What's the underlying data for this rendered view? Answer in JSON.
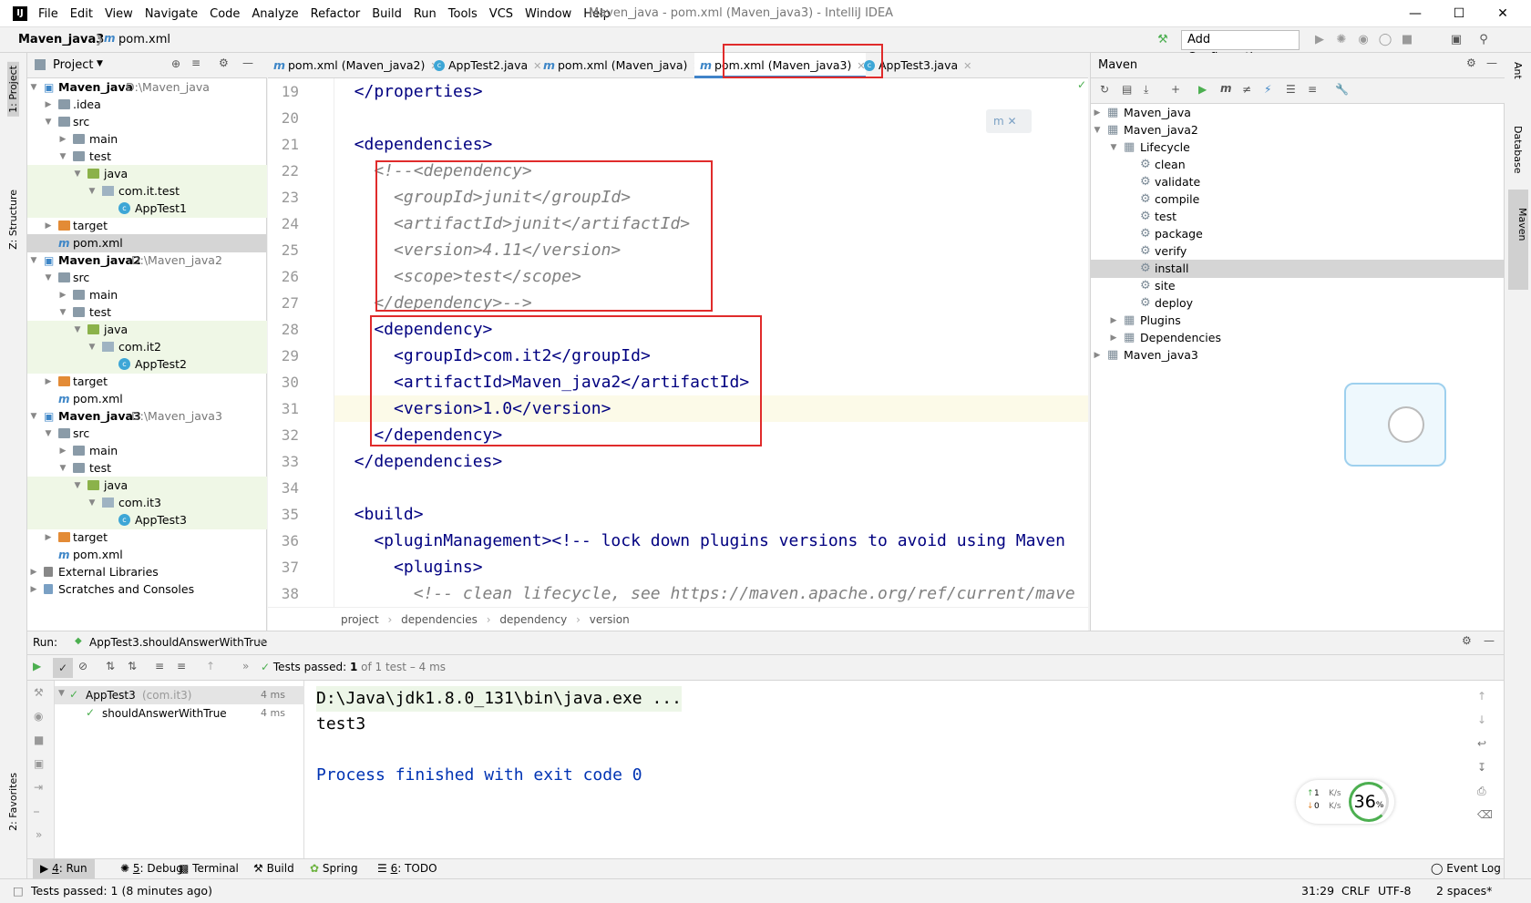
{
  "window": {
    "title": "Maven_java - pom.xml (Maven_java3) - IntelliJ IDEA",
    "logo": "IJ"
  },
  "menu": [
    "File",
    "Edit",
    "View",
    "Navigate",
    "Code",
    "Analyze",
    "Refactor",
    "Build",
    "Run",
    "Tools",
    "VCS",
    "Window",
    "Help"
  ],
  "navbar": {
    "project": "Maven_java3",
    "file": "pom.xml",
    "add_config": "Add Configuration..."
  },
  "left_strip": {
    "project": "1: Project",
    "structure": "Z: Structure",
    "favorites": "2: Favorites"
  },
  "right_strip": {
    "ant": "Ant",
    "database": "Database",
    "maven": "Maven"
  },
  "project_panel": {
    "title": "Project",
    "rows": [
      {
        "label": "Maven_java",
        "path": "D:\\Maven_java",
        "bold": true
      },
      {
        "label": ".idea"
      },
      {
        "label": "src"
      },
      {
        "label": "main"
      },
      {
        "label": "test"
      },
      {
        "label": "java"
      },
      {
        "label": "com.it.test"
      },
      {
        "label": "AppTest1"
      },
      {
        "label": "target"
      },
      {
        "label": "pom.xml"
      },
      {
        "label": "Maven_java2",
        "path": "D:\\Maven_java2",
        "bold": true
      },
      {
        "label": "src"
      },
      {
        "label": "main"
      },
      {
        "label": "test"
      },
      {
        "label": "java"
      },
      {
        "label": "com.it2"
      },
      {
        "label": "AppTest2"
      },
      {
        "label": "target"
      },
      {
        "label": "pom.xml"
      },
      {
        "label": "Maven_java3",
        "path": "D:\\Maven_java3",
        "bold": true
      },
      {
        "label": "src"
      },
      {
        "label": "main"
      },
      {
        "label": "test"
      },
      {
        "label": "java"
      },
      {
        "label": "com.it3"
      },
      {
        "label": "AppTest3"
      },
      {
        "label": "target"
      },
      {
        "label": "pom.xml"
      },
      {
        "label": "External Libraries"
      },
      {
        "label": "Scratches and Consoles"
      }
    ]
  },
  "editor": {
    "tabs": [
      "pom.xml (Maven_java2)",
      "AppTest2.java",
      "pom.xml (Maven_java)",
      "pom.xml (Maven_java3)",
      "AppTest3.java"
    ],
    "line_numbers": [
      "19",
      "20",
      "21",
      "22",
      "23",
      "24",
      "25",
      "26",
      "27",
      "28",
      "29",
      "30",
      "31",
      "32",
      "33",
      "34",
      "35",
      "36",
      "37",
      "38"
    ],
    "lines": [
      "  </properties>",
      "",
      "  <dependencies>",
      "    <!--<dependency>",
      "      <groupId>junit</groupId>",
      "      <artifactId>junit</artifactId>",
      "      <version>4.11</version>",
      "      <scope>test</scope>",
      "    </dependency>-->",
      "    <dependency>",
      "      <groupId>com.it2</groupId>",
      "      <artifactId>Maven_java2</artifactId>",
      "      <version>1.0</version>",
      "    </dependency>",
      "  </dependencies>",
      "",
      "  <build>",
      "    <pluginManagement><!-- lock down plugins versions to avoid using Maven",
      "      <plugins>",
      "        <!-- clean lifecycle, see https://maven.apache.org/ref/current/mave"
    ],
    "breadcrumb": [
      "project",
      "dependencies",
      "dependency",
      "version"
    ]
  },
  "maven_panel": {
    "title": "Maven",
    "projects": [
      "Maven_java",
      "Maven_java2",
      "Maven_java3"
    ],
    "lifecycle_label": "Lifecycle",
    "phases": [
      "clean",
      "validate",
      "compile",
      "test",
      "package",
      "verify",
      "install",
      "site",
      "deploy"
    ],
    "plugins_label": "Plugins",
    "dependencies_label": "Dependencies"
  },
  "run_panel": {
    "label": "Run:",
    "tab": "AppTest3.shouldAnswerWithTrue",
    "status_prefix": "Tests passed:",
    "status_count": "1",
    "status_suffix": "of 1 test – 4 ms",
    "tree": [
      {
        "name": "AppTest3",
        "pkg": "(com.it3)",
        "time": "4 ms"
      },
      {
        "name": "shouldAnswerWithTrue",
        "time": "4 ms"
      }
    ],
    "console": [
      "D:\\Java\\jdk1.8.0_131\\bin\\java.exe ...",
      "test3",
      "",
      "Process finished with exit code 0"
    ]
  },
  "net_widget": {
    "up": "1",
    "down": "0",
    "unit": "K/s",
    "percent": "36",
    "percent_sign": "%"
  },
  "bottom_tabs": [
    {
      "num": "4",
      "label": ": Run"
    },
    {
      "num": "5",
      "label": ": Debug"
    },
    {
      "num": "",
      "label": "Terminal"
    },
    {
      "num": "",
      "label": "Build"
    },
    {
      "num": "",
      "label": "Spring"
    },
    {
      "num": "6",
      "label": ": TODO"
    }
  ],
  "event_log": "Event Log",
  "status": {
    "message": "Tests passed: 1 (8 minutes ago)",
    "position": "31:29",
    "line_sep": "CRLF",
    "encoding": "UTF-8",
    "indent": "2 spaces*"
  },
  "colors": {
    "accent": "#4083c9",
    "highlight_box": "#e02b2b",
    "xml_tag": "#000080",
    "comment": "#808080",
    "test_folder": "#eff7e6"
  }
}
